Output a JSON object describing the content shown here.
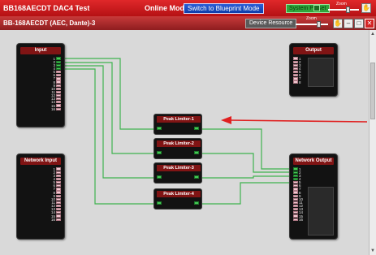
{
  "app_bar": {
    "title": "BB168AECDT DAC4 Test",
    "mode": "Online Mode",
    "blueprint_button": "Switch to Blueprint Mode",
    "preset_button": "System Preset",
    "zoom_label": "Zoom"
  },
  "sub_bar": {
    "title": "BB-168AECDT (AEC, Dante)-3",
    "device_resource_button": "Device Resource",
    "zoom_label": "Zoom"
  },
  "blocks": {
    "input": {
      "title": "Input",
      "ports": [
        "1",
        "2",
        "3",
        "4",
        "5",
        "6",
        "7",
        "8",
        "9",
        "10",
        "11",
        "12",
        "13",
        "14",
        "15",
        "16"
      ]
    },
    "output": {
      "title": "Output",
      "ports": [
        "1",
        "2",
        "3",
        "4",
        "5",
        "6",
        "7",
        "8"
      ]
    },
    "network_input": {
      "title": "Network Input",
      "ports": [
        "1",
        "2",
        "3",
        "4",
        "5",
        "6",
        "7",
        "8",
        "9",
        "10",
        "11",
        "12",
        "13",
        "14",
        "15",
        "16"
      ]
    },
    "network_output": {
      "title": "Network Output",
      "ports": [
        "1",
        "2",
        "3",
        "4",
        "5",
        "6",
        "7",
        "8",
        "9",
        "10",
        "11",
        "12",
        "13",
        "14",
        "15",
        "16"
      ]
    }
  },
  "limiters": [
    {
      "title": "Peak Limiter-1"
    },
    {
      "title": "Peak Limiter-2"
    },
    {
      "title": "Peak Limiter-3"
    },
    {
      "title": "Peak Limiter-4"
    }
  ],
  "colors": {
    "wire": "#3fb34f",
    "annotation_arrow": "#e02020",
    "title_bar": "#c41a1d"
  }
}
